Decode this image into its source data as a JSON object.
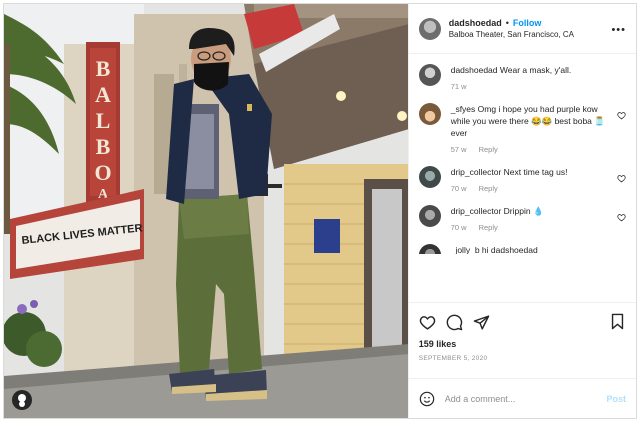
{
  "post": {
    "username": "dadshoedad",
    "separator": "•",
    "follow_label": "Follow",
    "location": "Balboa Theater, San Francisco, CA"
  },
  "photo": {
    "marquee_text": "BLACK LIVES MATTER",
    "vertical_sign": "BALBOA"
  },
  "comments": [
    {
      "user": "dadshoedad",
      "text": "Wear a mask, y'all.",
      "age": "71 w",
      "reply": ""
    },
    {
      "user": "_sfyes",
      "text": "Omg i hope you had purple kow while you were there 😂😂 best boba 🫙 ever",
      "age": "57 w",
      "reply": "Reply"
    },
    {
      "user": "drip_collector",
      "text": "Next time tag us!",
      "age": "70 w",
      "reply": "Reply"
    },
    {
      "user": "drip_collector",
      "text": "Drippin 💧",
      "age": "70 w",
      "reply": "Reply"
    },
    {
      "user": "_jolly_b",
      "text": "hi dadshoedad",
      "age": "",
      "reply": ""
    }
  ],
  "actions": {
    "likes": "159 likes",
    "date": "SEPTEMBER 5, 2020"
  },
  "add_comment": {
    "placeholder": "Add a comment...",
    "post_label": "Post"
  },
  "colors": {
    "link_blue": "#0095f6",
    "post_disabled": "#b2dffc",
    "meta_gray": "#8e8e8e"
  },
  "icons": [
    "more-options-icon",
    "heart-icon",
    "comment-icon",
    "share-icon",
    "bookmark-icon",
    "emoji-icon",
    "user-tag-icon"
  ]
}
